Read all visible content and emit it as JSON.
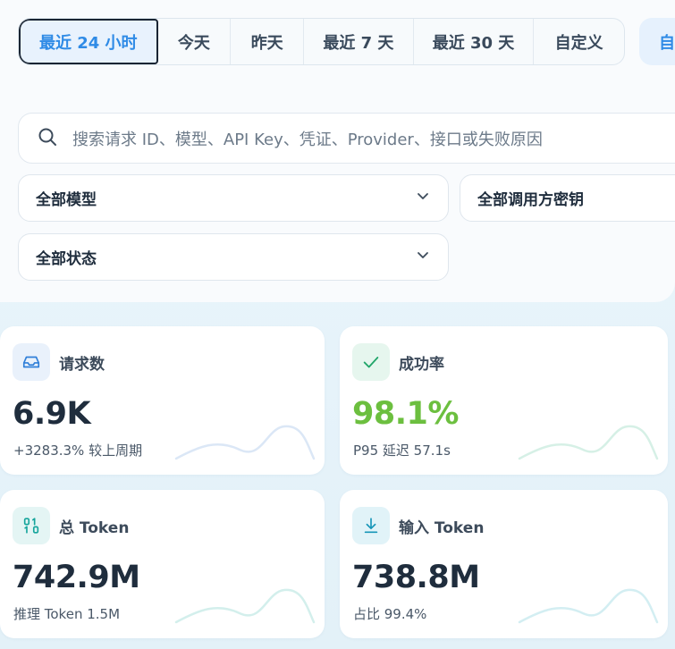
{
  "time_range": {
    "tabs": [
      "最近 24 小时",
      "今天",
      "昨天",
      "最近 7 天",
      "最近 30 天",
      "自定义"
    ],
    "active_index": 0,
    "extra_button_label": "自"
  },
  "search": {
    "placeholder": "搜索请求 ID、模型、API Key、凭证、Provider、接口或失败原因"
  },
  "filters": {
    "model": "全部模型",
    "caller_key": "全部调用方密钥",
    "status": "全部状态"
  },
  "stats": [
    {
      "icon": "inbox-icon",
      "title": "请求数",
      "value": "6.9K",
      "sub": "+3283.3% 较上周期",
      "value_color": "#1f2d3d",
      "icon_bg": "#e9f1fb",
      "icon_color": "#2f7fd8",
      "spark_color": "#dbe7f6"
    },
    {
      "icon": "check-icon",
      "title": "成功率",
      "value": "98.1%",
      "sub": "P95 延迟 57.1s",
      "value_color": "#6cbf3f",
      "icon_bg": "#e6f6ee",
      "icon_color": "#22a66a",
      "spark_color": "#d6f0e6"
    },
    {
      "icon": "binary-icon",
      "title": "总 Token",
      "value": "742.9M",
      "sub": "推理 Token 1.5M",
      "value_color": "#1f2d3d",
      "icon_bg": "#e4f5f4",
      "icon_color": "#16a59c",
      "spark_color": "#d3efec"
    },
    {
      "icon": "download-icon",
      "title": "输入 Token",
      "value": "738.8M",
      "sub": "占比 99.4%",
      "value_color": "#1f2d3d",
      "icon_bg": "#e1f3f8",
      "icon_color": "#1796b8",
      "spark_color": "#d3eef2"
    }
  ]
}
